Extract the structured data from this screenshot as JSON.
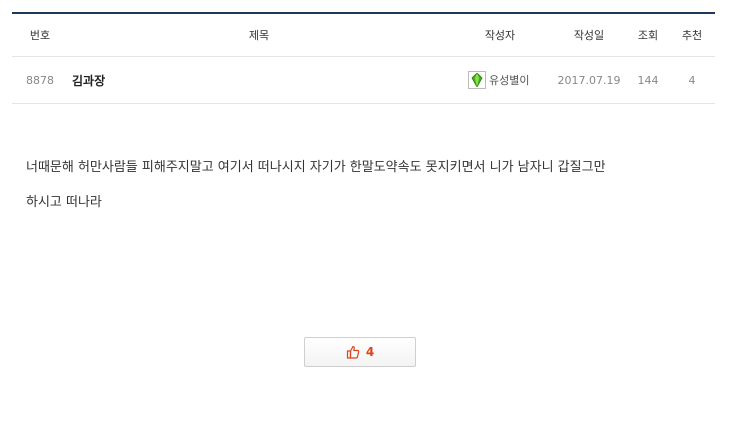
{
  "header": {
    "col_no": "번호",
    "col_title": "제목",
    "col_author": "작성자",
    "col_date": "작성일",
    "col_views": "조회",
    "col_recommend": "추천"
  },
  "post": {
    "number": "8878",
    "title": "김과장",
    "author": "유성별이",
    "author_icon": "green-crystal-level-icon",
    "date": "2017.07.19",
    "views": "144",
    "recommend": "4"
  },
  "content": {
    "line1": "너때문해 허만사람들 피해주지말고 여기서 떠나시지 자기가 한말도약속도 못지키면서 니가 남자니 갑질그만",
    "line2": "하시고 떠나라"
  },
  "recommend_button": {
    "icon": "thumbs-up-icon",
    "count": "4"
  },
  "colors": {
    "top_border": "#1f3a56",
    "recommend_count": "#d9441c",
    "level_icon": "#4caf1e"
  }
}
